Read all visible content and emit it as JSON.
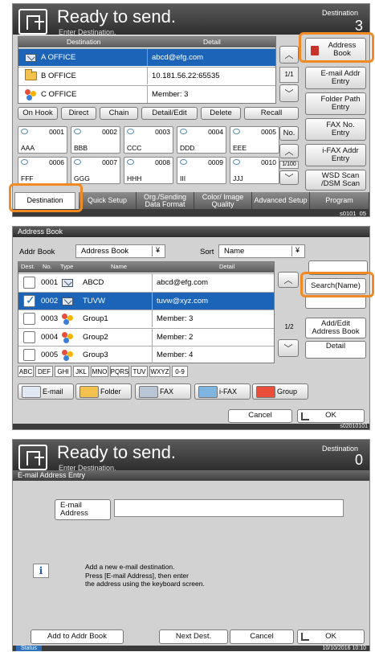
{
  "s1": {
    "title": "Ready to send.",
    "subtitle": "Enter Destination.",
    "corner_label": "Destination",
    "count": "3",
    "table_header": {
      "destination": "Destination",
      "detail": "Detail"
    },
    "rows": [
      {
        "name": "A OFFICE",
        "detail": "abcd@efg.com",
        "icon": "email-icon"
      },
      {
        "name": "B OFFICE",
        "detail": "10.181.56.22:65535",
        "icon": "folder-icon"
      },
      {
        "name": "C OFFICE",
        "detail": "Member:   3",
        "icon": "group-icon"
      }
    ],
    "page": "1/1",
    "actions": [
      "On Hook",
      "Direct",
      "Chain",
      "Detail/Edit",
      "Delete",
      "Recall"
    ],
    "right_buttons": [
      "Address Book",
      "E-mail Addr Entry",
      "Folder Path Entry",
      "FAX No. Entry",
      "i-FAX Addr Entry",
      "WSD Scan /DSM Scan"
    ],
    "one_touch": [
      {
        "num": "0001",
        "label": "AAA"
      },
      {
        "num": "0002",
        "label": "BBB"
      },
      {
        "num": "0003",
        "label": "CCC"
      },
      {
        "num": "0004",
        "label": "DDD"
      },
      {
        "num": "0005",
        "label": "EEE"
      },
      {
        "num": "0006",
        "label": "FFF"
      },
      {
        "num": "0007",
        "label": "GGG"
      },
      {
        "num": "0008",
        "label": "HHH"
      },
      {
        "num": "0009",
        "label": "III"
      },
      {
        "num": "0010",
        "label": "JJJ"
      }
    ],
    "no_button": "No.",
    "key_page": "1/100",
    "tabs": [
      "Destination",
      "Quick Setup",
      "Org./Sending Data Format",
      "Color/ Image Quality",
      "Advanced Setup",
      "Program"
    ],
    "code": "s0101_05"
  },
  "s2": {
    "title": "Address Book",
    "addr_label": "Addr Book",
    "addr_value": "Address Book",
    "sort_label": "Sort",
    "sort_value": "Name",
    "header": {
      "dest": "Dest.",
      "no": "No.",
      "type": "Type",
      "name": "Name",
      "detail": "Detail"
    },
    "rows": [
      {
        "no": "0001",
        "name": "ABCD",
        "detail": "abcd@efg.com",
        "checked": false,
        "icon": "email-icon"
      },
      {
        "no": "0002",
        "name": "TUVW",
        "detail": "tuvw@xyz.com",
        "checked": true,
        "icon": "email-icon"
      },
      {
        "no": "0003",
        "name": "Group1",
        "detail": "Member:   3",
        "checked": false,
        "icon": "group-icon"
      },
      {
        "no": "0004",
        "name": "Group2",
        "detail": "Member:   2",
        "checked": false,
        "icon": "group-icon"
      },
      {
        "no": "0005",
        "name": "Group3",
        "detail": "Member:   4",
        "checked": false,
        "icon": "group-icon"
      }
    ],
    "page": "1/2",
    "right_buttons": [
      "Search(Name)",
      "Add/Edit Address Book",
      "Detail"
    ],
    "index_keys": [
      "ABC",
      "DEF",
      "GHI",
      "JKL",
      "MNO",
      "PQRS",
      "TUV",
      "WXYZ",
      "0-9"
    ],
    "type_buttons": [
      "E-mail",
      "Folder",
      "FAX",
      "i-FAX",
      "Group"
    ],
    "cancel": "Cancel",
    "ok": "OK",
    "code": "s02010101"
  },
  "s3": {
    "title": "Ready to send.",
    "subtitle": "Enter Destination.",
    "corner_label": "Destination",
    "count": "0",
    "bar_title": "E-mail Address Entry",
    "field_label": "E-mail Address",
    "field_value": "",
    "info": "Add a new e-mail destination.\nPress [E-mail Address], then enter\nthe address using the keyboard screen.",
    "buttons": {
      "add": "Add to Addr Book",
      "next": "Next Dest.",
      "cancel": "Cancel",
      "ok": "OK"
    },
    "status": "Status",
    "datetime": "10/10/2016  10:10"
  },
  "colors": {
    "accent": "#f08a24",
    "selection": "#1b64b8",
    "header": "#3b3b3b"
  }
}
